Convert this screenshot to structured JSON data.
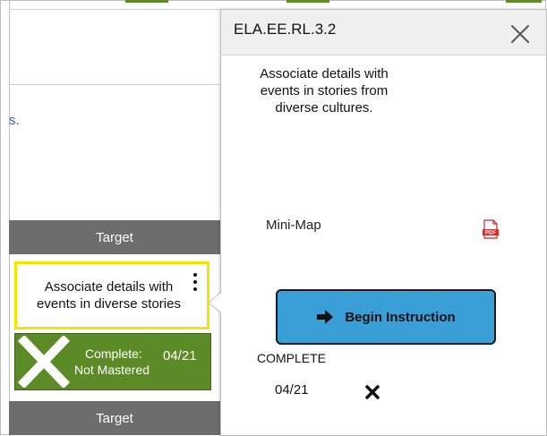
{
  "left": {
    "fragment": "s.",
    "target_label": "Target",
    "target_label_2": "Target",
    "card": {
      "text": "Associate details with events in diverse stories"
    },
    "status": {
      "line1": "Complete:",
      "date": "04/21",
      "line2": "Not Mastered",
      "color": "#5c8a27"
    }
  },
  "popup": {
    "title": "ELA.EE.RL.3.2",
    "description": "Associate details with events in stories from diverse cultures.",
    "mini_map": "Mini-Map",
    "begin_button": "Begin Instruction",
    "complete_label": "COMPLETE",
    "complete_date": "04/21",
    "accent": "#3a9fd6"
  },
  "icons": {
    "close": "close-icon",
    "pdf": "pdf-icon",
    "arrow": "arrow-right-icon",
    "not_mastered": "x-icon",
    "kebab": "kebab-menu-icon"
  }
}
